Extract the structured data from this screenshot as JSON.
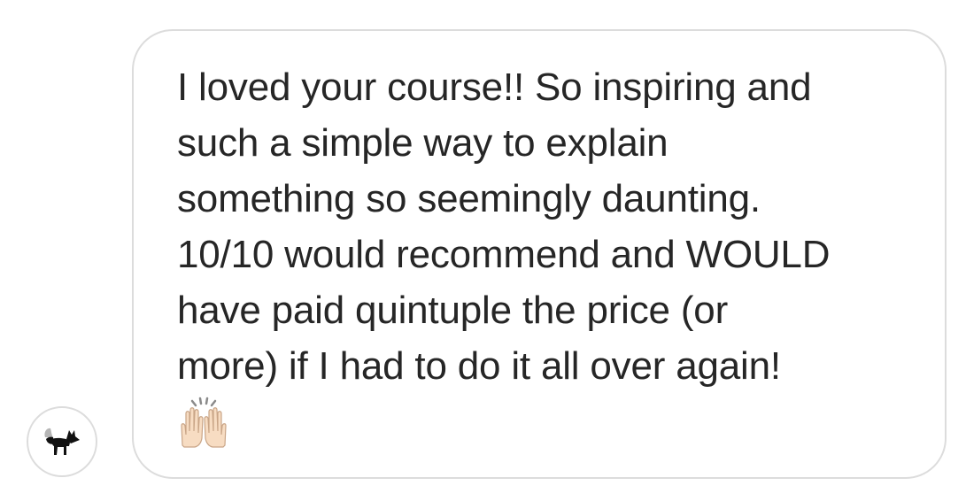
{
  "message": {
    "text": "I loved your course!! So inspiring and\nsuch a simple way to explain\nsomething so seemingly daunting.\n10/10 would recommend and WOULD\nhave paid quintuple the price (or\nmore) if I had to do it all over again!",
    "emoji": "raising-hands-emoji"
  },
  "sender": {
    "avatar_icon": "fox-icon"
  },
  "colors": {
    "bubble_border": "#dcdcdc",
    "text": "#262626"
  }
}
